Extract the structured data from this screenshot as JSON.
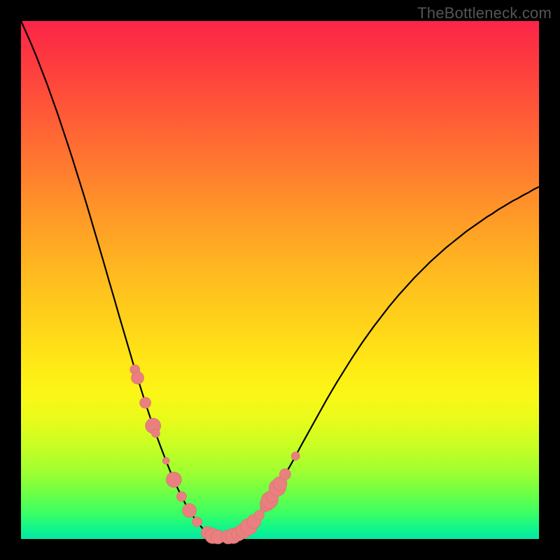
{
  "watermark": "TheBottleneck.com",
  "colors": {
    "frame": "#000000",
    "gradient_top": "#fb2448",
    "gradient_bottom": "#06e7a4",
    "curve": "#000000",
    "dot_fill": "#e97f7f"
  },
  "chart_data": {
    "type": "line",
    "title": "",
    "xlabel": "",
    "ylabel": "",
    "xlim": [
      0,
      100
    ],
    "ylim": [
      0,
      100
    ],
    "x": [
      0,
      1,
      2,
      3,
      4,
      5,
      6,
      7,
      8,
      9,
      10,
      11,
      12,
      13,
      14,
      15,
      16,
      17,
      18,
      19,
      20,
      21,
      22,
      23,
      24,
      25,
      26,
      27,
      28,
      29,
      30,
      31,
      32,
      33,
      34,
      35,
      36,
      37,
      38,
      39,
      40,
      41,
      42,
      43,
      44,
      45,
      46,
      47,
      48,
      49,
      50,
      51,
      52,
      53,
      54,
      55,
      56,
      57,
      58,
      59,
      60,
      61,
      62,
      63,
      64,
      65,
      66,
      67,
      68,
      69,
      70,
      71,
      72,
      73,
      74,
      75,
      76,
      77,
      78,
      79,
      80,
      81,
      82,
      83,
      84,
      85,
      86,
      87,
      88,
      89,
      90,
      91,
      92,
      93,
      94,
      95,
      96,
      97,
      98,
      99,
      100
    ],
    "y": [
      100,
      97.8,
      95.5,
      93.1,
      90.5,
      87.9,
      85.1,
      82.3,
      79.3,
      76.3,
      73.2,
      70.0,
      66.8,
      63.5,
      60.1,
      56.7,
      53.3,
      49.8,
      46.4,
      42.9,
      39.5,
      36.1,
      32.7,
      29.5,
      26.3,
      23.3,
      20.4,
      17.7,
      15.1,
      12.6,
      10.3,
      8.2,
      6.3,
      4.7,
      3.3,
      2.1,
      1.2,
      0.6,
      0.4,
      0.4,
      0.4,
      0.6,
      1.0,
      1.6,
      2.4,
      3.4,
      4.6,
      6.0,
      7.5,
      9.1,
      10.7,
      12.5,
      14.2,
      16.0,
      17.9,
      19.7,
      21.5,
      23.3,
      25.1,
      26.9,
      28.6,
      30.3,
      31.9,
      33.5,
      35.1,
      36.6,
      38.1,
      39.5,
      40.9,
      42.2,
      43.5,
      44.8,
      46.0,
      47.2,
      48.3,
      49.4,
      50.5,
      51.5,
      52.5,
      53.5,
      54.4,
      55.3,
      56.2,
      57.0,
      57.8,
      58.6,
      59.4,
      60.1,
      60.8,
      61.5,
      62.2,
      62.8,
      63.5,
      64.1,
      64.7,
      65.3,
      65.8,
      66.4,
      66.9,
      67.5,
      68.0
    ],
    "markers_x": [
      22,
      22.5,
      24,
      25.5,
      26,
      28,
      29.5,
      31,
      32.5,
      34,
      36,
      37,
      38,
      40,
      41,
      42,
      42.5,
      43,
      44,
      45,
      46,
      47,
      47.5,
      48,
      48.5,
      49.5,
      50,
      51,
      53
    ],
    "markers_r": [
      7,
      9,
      8,
      11,
      6,
      5,
      11,
      7,
      10,
      7,
      9,
      11,
      10,
      10,
      11,
      10,
      7,
      11,
      12,
      10,
      7,
      6,
      10,
      12,
      9,
      12,
      10,
      8,
      6
    ]
  }
}
